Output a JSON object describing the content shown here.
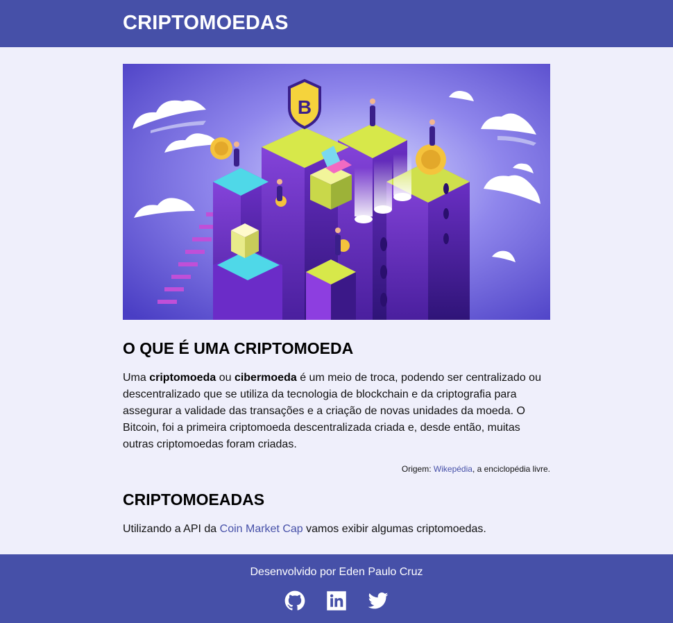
{
  "header": {
    "title": "CRIPTOMOEDAS"
  },
  "colors": {
    "brand": "#4650a8",
    "background": "#efeffb",
    "link": "#4650a8"
  },
  "hero": {
    "icon": "crypto-city-illustration"
  },
  "what": {
    "heading": "O QUE É UMA CRIPTOMOEDA",
    "p1": "Uma ",
    "term1": "criptomoeda",
    "p2": " ou ",
    "term2": "cibermoeda",
    "p3": " é um meio de troca, podendo ser centralizado ou descentralizado que se utiliza da tecnologia de blockchain e da criptografia para assegurar a validade das transações e a criação de novas unidades da moeda. O Bitcoin, foi a primeira criptomoeda descentralizada criada e, desde então, muitas outras criptomoedas foram criadas."
  },
  "source": {
    "prefix": "Origem: ",
    "link": "Wikepédia",
    "suffix": ", a enciclopédia livre."
  },
  "list": {
    "heading": "CRIPTOMOEADAS",
    "prefix": "Utilizando a API da ",
    "link": "Coin Market Cap",
    "suffix": " vamos exibir algumas criptomoedas."
  },
  "footer": {
    "credit": "Desenvolvido por Eden Paulo Cruz",
    "icons": [
      "github-icon",
      "linkedin-icon",
      "twitter-icon"
    ]
  }
}
